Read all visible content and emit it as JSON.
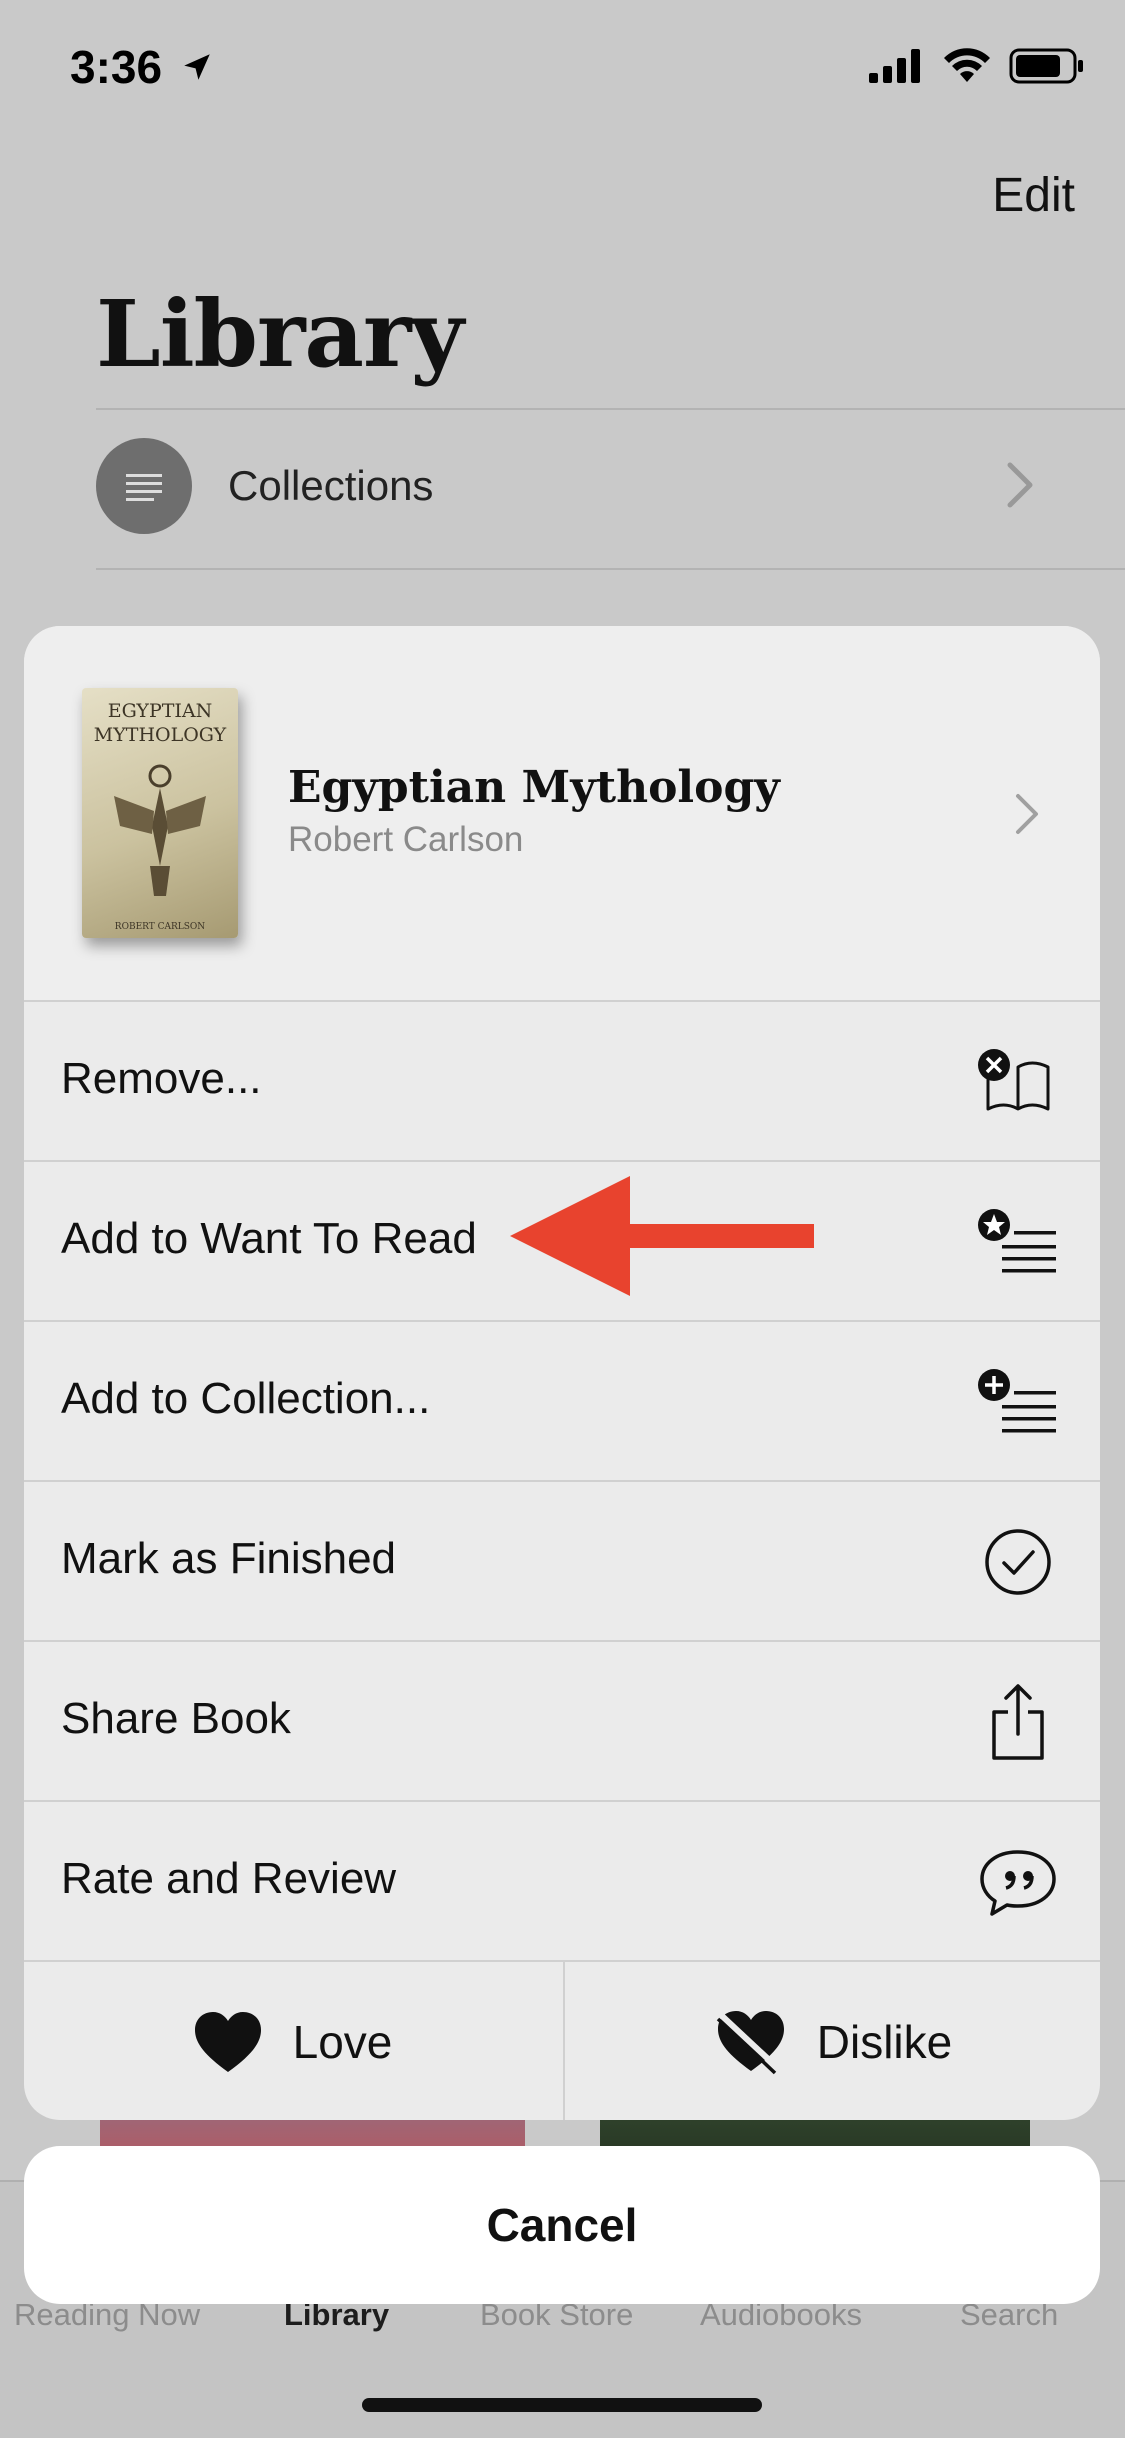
{
  "status_bar": {
    "time": "3:36"
  },
  "header": {
    "edit_label": "Edit",
    "title": "Library"
  },
  "collections_row": {
    "label": "Collections"
  },
  "book": {
    "title": "Egyptian Mythology",
    "author": "Robert Carlson",
    "cover_title_line1": "EGYPTIAN",
    "cover_title_line2": "MYTHOLOGY",
    "cover_author": "ROBERT CARLSON"
  },
  "actions": [
    {
      "label": "Remove...",
      "icon": "remove-book-icon"
    },
    {
      "label": "Add to Want To Read",
      "icon": "want-to-read-icon"
    },
    {
      "label": "Add to Collection...",
      "icon": "add-collection-icon"
    },
    {
      "label": "Mark as Finished",
      "icon": "checkmark-circle-icon"
    },
    {
      "label": "Share Book",
      "icon": "share-icon"
    },
    {
      "label": "Rate and Review",
      "icon": "quote-bubble-icon"
    }
  ],
  "love": {
    "label": "Love",
    "icon": "heart-icon"
  },
  "dislike": {
    "label": "Dislike",
    "icon": "heart-slash-icon"
  },
  "cancel": {
    "label": "Cancel"
  },
  "tabs": [
    {
      "label": "Reading Now"
    },
    {
      "label": "Library",
      "active": true
    },
    {
      "label": "Book Store"
    },
    {
      "label": "Audiobooks"
    },
    {
      "label": "Search"
    }
  ],
  "colors": {
    "annotation_arrow": "#e8432e"
  }
}
